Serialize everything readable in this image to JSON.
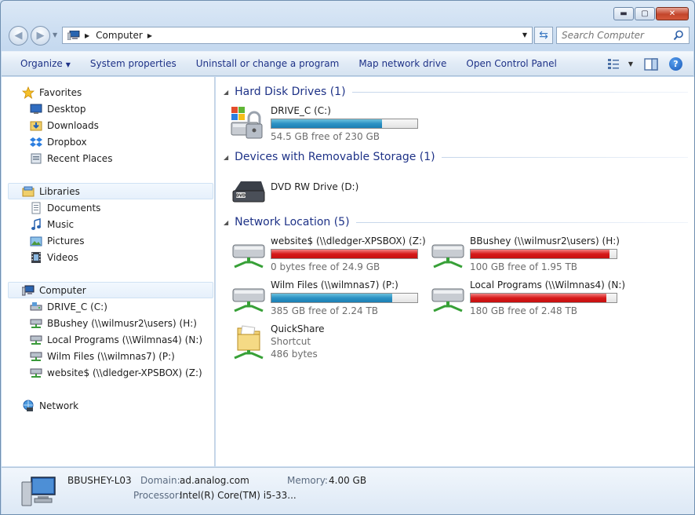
{
  "window": {
    "caption": {
      "minimize": "▬",
      "maximize": "▢",
      "close": "✕"
    }
  },
  "address_bar": {
    "crumb": "Computer",
    "search_placeholder": "Search Computer"
  },
  "toolbar": {
    "organize": "Organize",
    "system_properties": "System properties",
    "uninstall": "Uninstall or change a program",
    "map_drive": "Map network drive",
    "control_panel": "Open Control Panel",
    "help": "?"
  },
  "nav": {
    "favorites": {
      "label": "Favorites",
      "items": [
        "Desktop",
        "Downloads",
        "Dropbox",
        "Recent Places"
      ]
    },
    "libraries": {
      "label": "Libraries",
      "items": [
        "Documents",
        "Music",
        "Pictures",
        "Videos"
      ]
    },
    "computer": {
      "label": "Computer",
      "items": [
        "DRIVE_C (C:)",
        "BBushey (\\\\wilmusr2\\users) (H:)",
        "Local Programs (\\\\Wilmnas4) (N:)",
        "Wilm Files (\\\\wilmnas7) (P:)",
        "website$ (\\\\dledger-XPSBOX) (Z:)"
      ]
    },
    "network": {
      "label": "Network"
    }
  },
  "groups": {
    "hdd": {
      "header": "Hard Disk Drives (1)",
      "drives": [
        {
          "name": "DRIVE_C (C:)",
          "free": "54.5 GB free of 230 GB",
          "used_fraction": 0.76,
          "color": "#2c92c4"
        }
      ]
    },
    "removable": {
      "header": "Devices with Removable Storage (1)",
      "devices": [
        {
          "name": "DVD RW Drive (D:)"
        }
      ]
    },
    "network": {
      "header": "Network Location (5)",
      "drives": [
        {
          "name": "website$ (\\\\dledger-XPSBOX) (Z:)",
          "free": "0 bytes free of 24.9 GB",
          "used_fraction": 1.0,
          "color": "#d61a1a"
        },
        {
          "name": "BBushey (\\\\wilmusr2\\users) (H:)",
          "free": "100 GB free of 1.95 TB",
          "used_fraction": 0.95,
          "color": "#d61a1a"
        },
        {
          "name": "Wilm Files (\\\\wilmnas7) (P:)",
          "free": "385 GB free of 2.24 TB",
          "used_fraction": 0.83,
          "color": "#2c92c4"
        },
        {
          "name": "Local Programs (\\\\Wilmnas4) (N:)",
          "free": "180 GB free of 2.48 TB",
          "used_fraction": 0.93,
          "color": "#d61a1a"
        }
      ],
      "shortcut": {
        "name": "QuickShare",
        "type": "Shortcut",
        "size": "486 bytes"
      }
    }
  },
  "details": {
    "computer_name": "BBUSHEY-L03",
    "domain_label": "Domain:",
    "domain": "ad.analog.com",
    "memory_label": "Memory:",
    "memory": "4.00 GB",
    "processor_label": "Processor:",
    "processor": "Intel(R) Core(TM) i5-33..."
  }
}
